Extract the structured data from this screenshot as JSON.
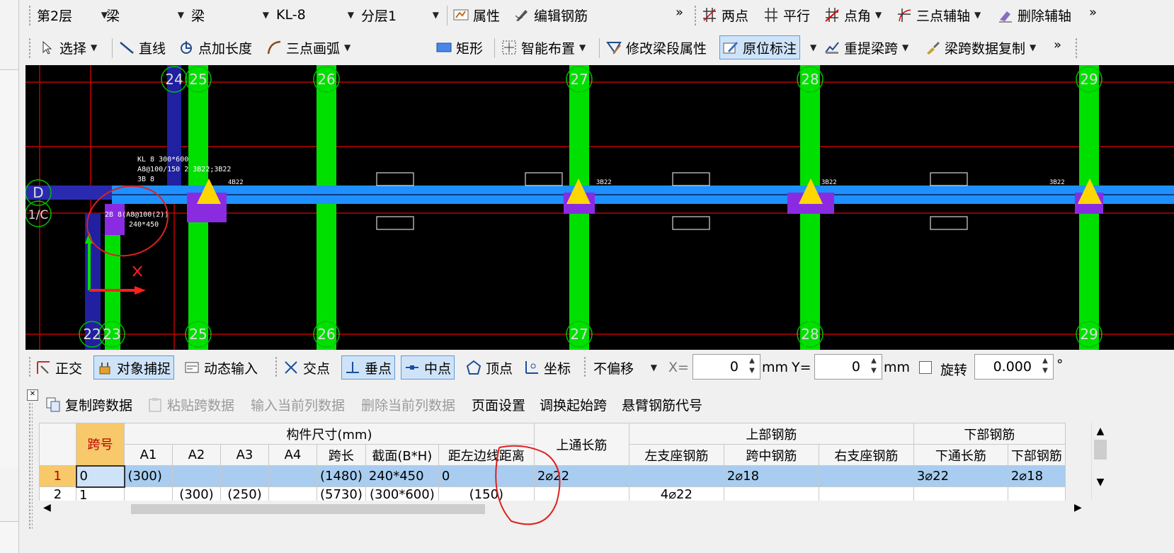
{
  "toolbar1": {
    "floor": "第2层",
    "category": "梁",
    "type": "梁",
    "element": "KL-8",
    "sublayer": "分层1",
    "properties": "属性",
    "edit_rebar": "编辑钢筋",
    "more": "»",
    "two_points": "两点",
    "parallel": "平行",
    "point_angle": "点角",
    "three_point_axis": "三点辅轴",
    "delete_axis": "删除辅轴",
    "more2": "»"
  },
  "toolbar2": {
    "select": "选择",
    "line": "直线",
    "point_length": "点加长度",
    "arc": "三点画弧",
    "rect": "矩形",
    "smart_layout": "智能布置",
    "modify_segment": "修改梁段属性",
    "in_place": "原位标注",
    "re_span": "重提梁跨",
    "copy_span": "梁跨数据复制",
    "more": "»"
  },
  "canvas": {
    "axis_top": [
      "24",
      "25",
      "26",
      "27",
      "28",
      "29"
    ],
    "axis_bottom": [
      "22",
      "23",
      "25",
      "26",
      "27",
      "28",
      "29"
    ],
    "axis_left": [
      "D",
      "1/C"
    ],
    "beam_label_line1": "KL 8 300*600",
    "beam_label_line2": "A8@100/150 2 3B22;3B22",
    "beam_label_line3": "3B 8",
    "top_rebar_1": "4B22",
    "top_rebar_2": "3B22",
    "top_rebar_3": "3B22",
    "top_rebar_4": "3B22",
    "cant_label": "2B 8(A8@100(2))",
    "cant_size": "240*450",
    "colors": {
      "beam": "#1e90ff",
      "column": "#00e000",
      "grid": "#d00000",
      "support": "#ffd700",
      "purple": "#8a2be2"
    }
  },
  "statusbar": {
    "ortho": "正交",
    "snap": "对象捕捉",
    "dyn_input": "动态输入",
    "intersect": "交点",
    "perp": "垂点",
    "mid": "中点",
    "vertex": "顶点",
    "coord": "坐标",
    "offset": "不偏移",
    "x_label": "X=",
    "x_value": "0",
    "mm1": "mm",
    "y_label": "Y=",
    "y_value": "0",
    "mm2": "mm",
    "rotate": "旋转",
    "rotate_value": "0.000",
    "degree": "°"
  },
  "panel_toolbar": {
    "copy_span": "复制跨数据",
    "paste_span": "粘贴跨数据",
    "input_col": "输入当前列数据",
    "delete_col": "删除当前列数据",
    "page_setup": "页面设置",
    "swap_start": "调换起始跨",
    "cantilever": "悬臂钢筋代号"
  },
  "table": {
    "group_size": "构件尺寸(mm)",
    "span_no": "跨号",
    "top_through": "上通长筋",
    "group_top": "上部钢筋",
    "group_bottom": "下部钢筋",
    "cols": [
      "A1",
      "A2",
      "A3",
      "A4",
      "跨长",
      "截面(B*H)",
      "距左边线距离",
      "左支座钢筋",
      "跨中钢筋",
      "右支座钢筋",
      "下通长筋",
      "下部钢筋"
    ],
    "rows": [
      {
        "no": "1",
        "span": "0",
        "a1": "(300)",
        "a2": "",
        "a3": "",
        "a4": "",
        "len": "(1480)",
        "sec": "240*450",
        "dist": "0",
        "top_through": "2⌀22",
        "left": "",
        "mid": "2⌀18",
        "right": "",
        "bot_through": "3⌀22",
        "bot": "2⌀18"
      },
      {
        "no": "2",
        "span": "1",
        "a1": "",
        "a2": "(300)",
        "a3": "(250)",
        "a4": "",
        "len": "(5730)",
        "sec": "(300*600)",
        "dist": "(150)",
        "top_through": "",
        "left": "4⌀22",
        "mid": "",
        "right": "",
        "bot_through": "",
        "bot": ""
      }
    ]
  }
}
